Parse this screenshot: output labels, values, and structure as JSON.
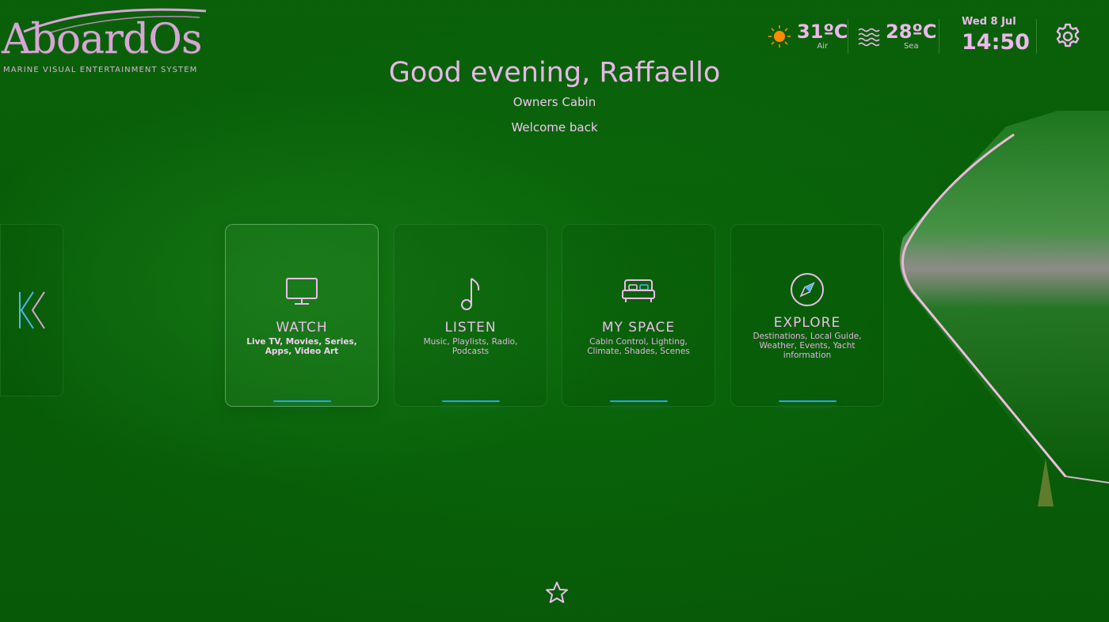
{
  "logo": {
    "wordmark": "AboardOs",
    "tagline": "MARINE VISUAL ENTERTAINMENT SYSTEM"
  },
  "weather": {
    "air": {
      "temp": "31ºC",
      "label": "Air",
      "icon": "sun-icon"
    },
    "sea": {
      "temp": "28ºC",
      "label": "Sea",
      "icon": "waves-icon"
    }
  },
  "clock": {
    "date": "Wed 8 Jul",
    "time": "14:50"
  },
  "header": {
    "greeting": "Good evening, Raffaello",
    "location": "Owners Cabin",
    "welcome": "Welcome back"
  },
  "tiles": [
    {
      "title": "WATCH",
      "subtitle": "Live TV, Movies, Series, Apps, Video Art",
      "icon": "tv-icon",
      "active": true
    },
    {
      "title": "LISTEN",
      "subtitle": "Music, Playlists, Radio, Podcasts",
      "icon": "music-note-icon",
      "active": false
    },
    {
      "title": "MY SPACE",
      "subtitle": "Cabin Control, Lighting, Climate, Shades, Scenes",
      "icon": "bed-icon",
      "active": false
    },
    {
      "title": "EXPLORE",
      "subtitle": "Destinations, Local Guide, Weather, Events, Yacht information",
      "icon": "compass-icon",
      "active": false
    }
  ],
  "colors": {
    "background": "#0b6a0b",
    "text": "#eab6ea",
    "accent_bar": "#2aa6e6",
    "sun": "#ff8a00"
  }
}
